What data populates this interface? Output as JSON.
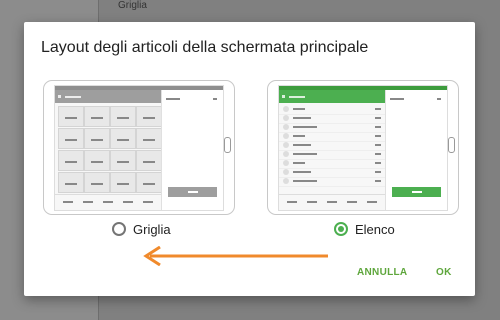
{
  "background": {
    "top_label": "Griglia"
  },
  "dialog": {
    "title": "Layout degli articoli della schermata principale",
    "options": [
      {
        "id": "grid",
        "label": "Griglia",
        "selected": false
      },
      {
        "id": "list",
        "label": "Elenco",
        "selected": true
      }
    ],
    "buttons": {
      "cancel": "ANNULLA",
      "ok": "OK"
    }
  },
  "colors": {
    "accent": "#4caf50",
    "button_text": "#5ea63c",
    "arrow": "#f08a2c",
    "grid_preview_toolbar": "#9e9e9e"
  },
  "annotations": {
    "arrow": {
      "direction": "left",
      "from": "list-option",
      "to": "grid-option"
    }
  }
}
